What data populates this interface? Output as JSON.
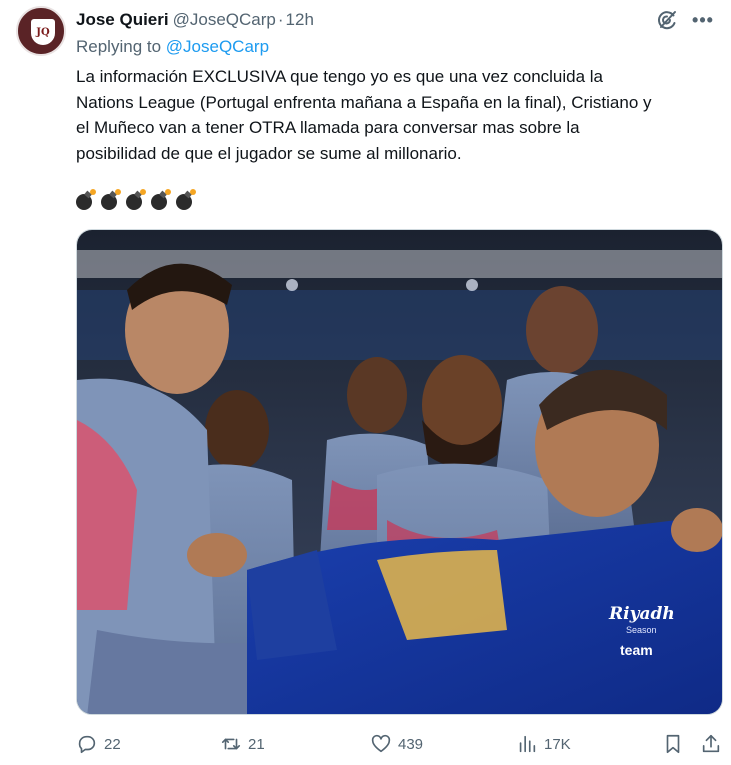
{
  "author": {
    "name": "Jose Quieri",
    "handle": "@JoseQCarp",
    "separator": "·",
    "time": "12h",
    "avatar_icon": "avatar-shield-icon"
  },
  "replying": {
    "prefix": "Replying to",
    "mention": "@JoseQCarp"
  },
  "tweet": {
    "text": "La información EXCLUSIVA que tengo yo es que una vez concluida la\nNations League (Portugal enfrenta mañana a España en la final), Cristiano y\nel Muñeco van a tener OTRA llamada para conversar mas sobre la\nposibilidad de que el jugador se sume al millonario.",
    "emojis": [
      "bomb-emoji",
      "bomb-emoji",
      "bomb-emoji",
      "bomb-emoji",
      "bomb-emoji"
    ]
  },
  "media": {
    "alt_icon": "photo-football-players",
    "jacket_text": "Riyadh",
    "jacket_sub": "Season",
    "jacket_team": "team"
  },
  "actions": {
    "replies": "22",
    "retweets": "21",
    "likes": "439",
    "views": "17K"
  },
  "colors": {
    "text": "#0f1419",
    "secondary": "#536471",
    "accent": "#1d9bf0",
    "border": "#cfd9de"
  }
}
